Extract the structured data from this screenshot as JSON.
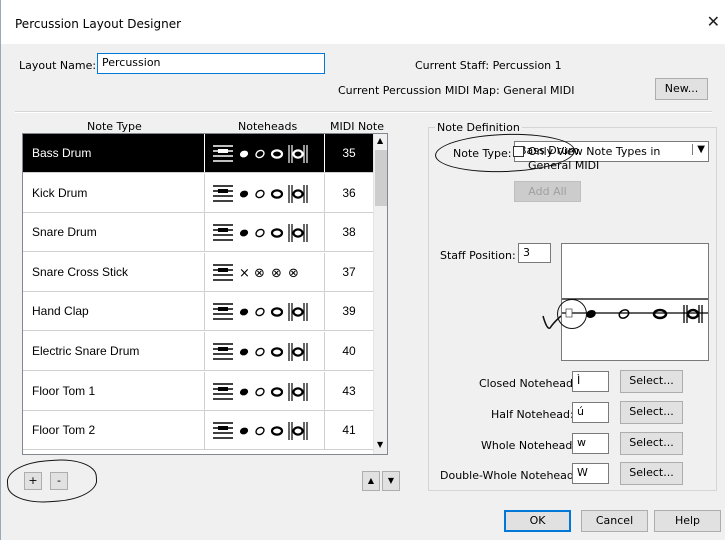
{
  "window": {
    "title": "Percussion Layout Designer"
  },
  "layout_name": {
    "label": "Layout Name:",
    "value": "Percussion"
  },
  "current_staff": "Current Staff: Percussion 1",
  "current_map": "Current Percussion MIDI Map: General MIDI",
  "new_button": "New...",
  "columns": {
    "note_type": "Note Type",
    "noteheads": "Noteheads",
    "midi_note": "MIDI Note"
  },
  "rows": [
    {
      "name": "Bass Drum",
      "midi": "35",
      "heads": "normal",
      "selected": true
    },
    {
      "name": "Kick Drum",
      "midi": "36",
      "heads": "normal",
      "selected": false
    },
    {
      "name": "Snare Drum",
      "midi": "38",
      "heads": "normal",
      "selected": false
    },
    {
      "name": "Snare Cross Stick",
      "midi": "37",
      "heads": "cross",
      "selected": false
    },
    {
      "name": "Hand Clap",
      "midi": "39",
      "heads": "normal",
      "selected": false
    },
    {
      "name": "Electric Snare Drum",
      "midi": "40",
      "heads": "normal",
      "selected": false
    },
    {
      "name": "Floor Tom 1",
      "midi": "43",
      "heads": "normal",
      "selected": false
    },
    {
      "name": "Floor Tom 2",
      "midi": "41",
      "heads": "normal",
      "selected": false
    }
  ],
  "add_button": "+",
  "remove_button": "-",
  "note_definition": {
    "group_label": "Note Definition",
    "note_type_label": "Note Type:",
    "note_type_value": "Bass Drum",
    "only_view_label_1": "Only View Note Types in",
    "only_view_label_2": "General MIDI",
    "only_view_checked": false,
    "add_all": "Add All",
    "staff_position_label": "Staff Position:",
    "staff_position_value": "3",
    "closed_label": "Closed Notehead:",
    "closed_value": "Ì",
    "half_label": "Half Notehead:",
    "half_value": "ú",
    "whole_label": "Whole Notehead:",
    "whole_value": "w",
    "dwhole_label": "Double-Whole Notehead:",
    "dwhole_value": "W",
    "select": "Select..."
  },
  "footer": {
    "ok": "OK",
    "cancel": "Cancel",
    "help": "Help"
  },
  "colors": {
    "selection": "#000000",
    "dialog_bg": "#f0f0f0",
    "default_border": "#0078d7",
    "annotation": "#111111"
  },
  "icons": [
    "close-icon",
    "chevron-up-icon",
    "chevron-down-icon",
    "dropdown-arrow-icon",
    "hand-drawn-circle-annotation"
  ]
}
